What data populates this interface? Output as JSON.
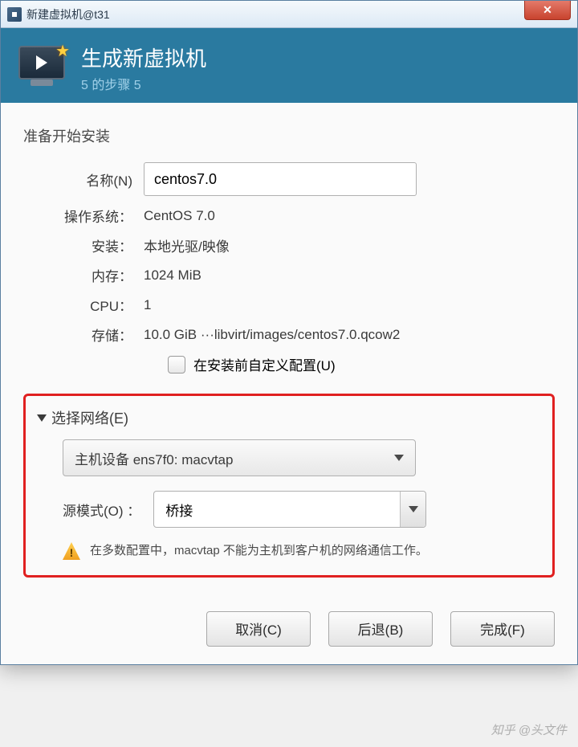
{
  "titlebar": {
    "title": "新建虚拟机@t31",
    "close_label": "✕"
  },
  "banner": {
    "title": "生成新虚拟机",
    "subtitle": "5 的步骤 5"
  },
  "section_heading": "准备开始安装",
  "name": {
    "label": "名称(N)",
    "value": "centos7.0"
  },
  "summary": {
    "os_label": "操作系统：",
    "os_value": "CentOS 7.0",
    "install_label": "安装：",
    "install_value": "本地光驱/映像",
    "memory_label": "内存：",
    "memory_value": "1024 MiB",
    "cpu_label": "CPU：",
    "cpu_value": "1",
    "storage_label": "存储：",
    "storage_value": "10.0 GiB ···libvirt/images/centos7.0.qcow2"
  },
  "customize_checkbox": {
    "label": "在安装前自定义配置(U)",
    "checked": false
  },
  "network": {
    "header": "选择网络(E)",
    "device_selected": "主机设备  ens7f0: macvtap",
    "source_mode_label": "源模式(O) ：",
    "source_mode_value": "桥接",
    "warning": "在多数配置中，macvtap 不能为主机到客户机的网络通信工作。"
  },
  "buttons": {
    "cancel": "取消(C)",
    "back": "后退(B)",
    "finish": "完成(F)"
  },
  "watermark": "知乎 @头文件"
}
